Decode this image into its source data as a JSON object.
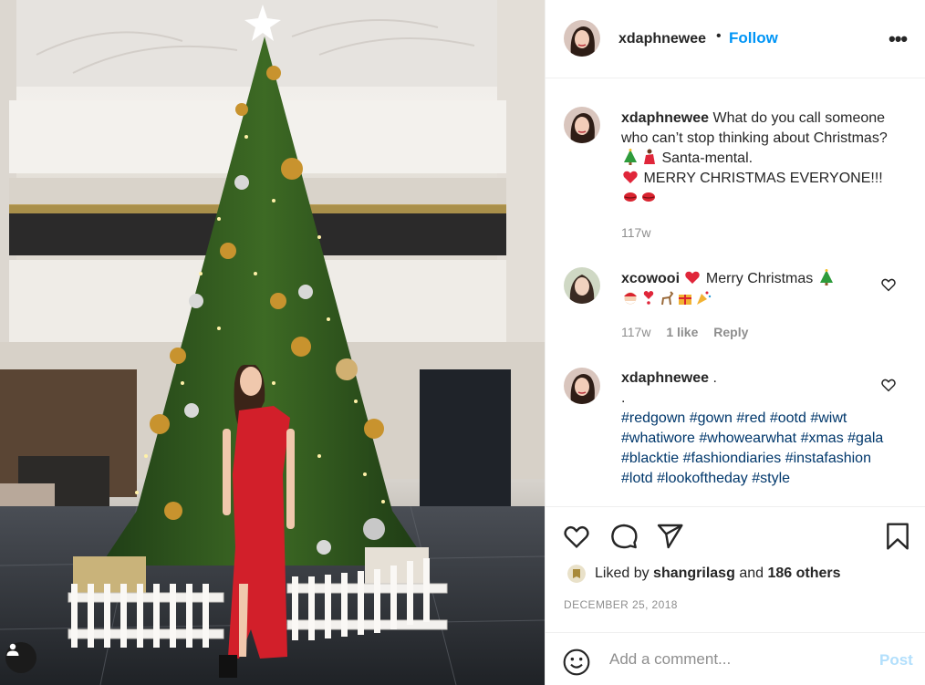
{
  "post": {
    "username": "xdaphnewee",
    "separator": "•",
    "follow_label": "Follow",
    "more_label": "•••"
  },
  "caption": {
    "username": "xdaphnewee",
    "text_line1": "What do you call someone who can’t stop thinking about Christmas?",
    "text_line2": "Santa-mental.",
    "text_line3": "MERRY CHRISTMAS EVERYONE!!!",
    "age": "117w"
  },
  "comments": [
    {
      "username": "xcowooi",
      "text": "Merry Christmas",
      "age": "117w",
      "likes": "1 like",
      "reply_label": "Reply"
    },
    {
      "username": "xdaphnewee",
      "text": ".",
      "text_line2": ".",
      "hashtags": [
        "#redgown",
        "#gown",
        "#red",
        "#ootd",
        "#wiwt",
        "#whatiwore",
        "#whowearwhat",
        "#xmas",
        "#gala",
        "#blacktie",
        "#fashiondiaries",
        "#instafashion",
        "#lotd",
        "#lookoftheday",
        "#style"
      ]
    }
  ],
  "liked_by": {
    "prefix": "Liked by",
    "user": "shangrilasg",
    "connector": "and",
    "others": "186 others"
  },
  "date": "DECEMBER 25, 2018",
  "comment_input": {
    "placeholder": "Add a comment...",
    "post_label": "Post"
  },
  "colors": {
    "link_blue": "#0095f6",
    "hashtag": "#00376b",
    "muted": "#8e8e8e",
    "heart_red": "#ed4956",
    "dress_red": "#d21f2a"
  }
}
